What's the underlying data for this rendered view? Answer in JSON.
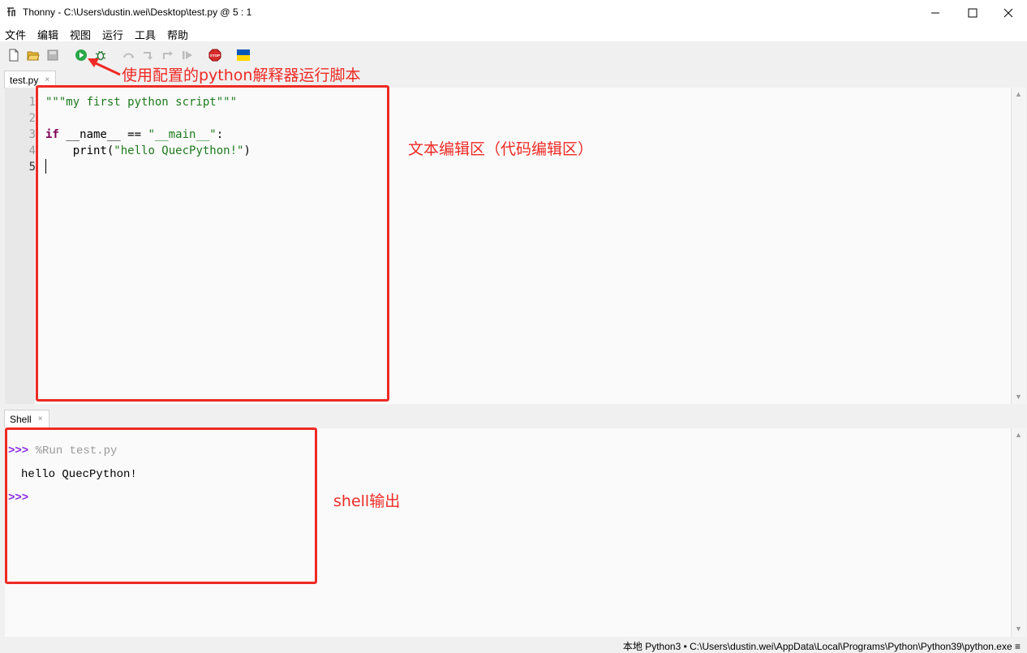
{
  "window": {
    "title": "Thonny  -  C:\\Users\\dustin.wei\\Desktop\\test.py  @  5 : 1"
  },
  "menu": [
    "文件",
    "编辑",
    "视图",
    "运行",
    "工具",
    "帮助"
  ],
  "toolbar": {
    "icons": [
      "new-file-icon",
      "open-file-icon",
      "save-file-icon",
      "run-icon",
      "debug-icon",
      "step-over-icon",
      "step-into-icon",
      "step-out-icon",
      "resume-icon",
      "stop-icon",
      "ukraine-flag-icon"
    ]
  },
  "editor": {
    "tab_label": "test.py",
    "tab_close": "×",
    "line_numbers": [
      "1",
      "2",
      "3",
      "4",
      "5"
    ],
    "lines": {
      "l1": "\"\"\"my first python script\"\"\"",
      "l3_kw": "if",
      "l3_name": " __name__ == ",
      "l3_str": "\"__main__\"",
      "l3_colon": ":",
      "l4_func": "    print(",
      "l4_str": "\"hello QuecPython!\"",
      "l4_close": ")"
    }
  },
  "shell": {
    "tab_label": "Shell",
    "tab_close": "×",
    "prompt": ">>>",
    "command": "%Run test.py",
    "output": "hello QuecPython!",
    "prompt2": ">>>"
  },
  "annotations": {
    "run_hint": "使用配置的python解释器运行脚本",
    "editor_area": "文本编辑区（代码编辑区）",
    "shell_output": "shell输出"
  },
  "status": {
    "text": "本地 Python3  •  C:\\Users\\dustin.wei\\AppData\\Local\\Programs\\Python\\Python39\\python.exe  ≡"
  },
  "colors": {
    "annotation_red": "#ee2a24",
    "keyword": "#7f0055",
    "string": "#1e7a1e",
    "prompt": "#8a2be2",
    "run_green": "#2aa84a"
  }
}
